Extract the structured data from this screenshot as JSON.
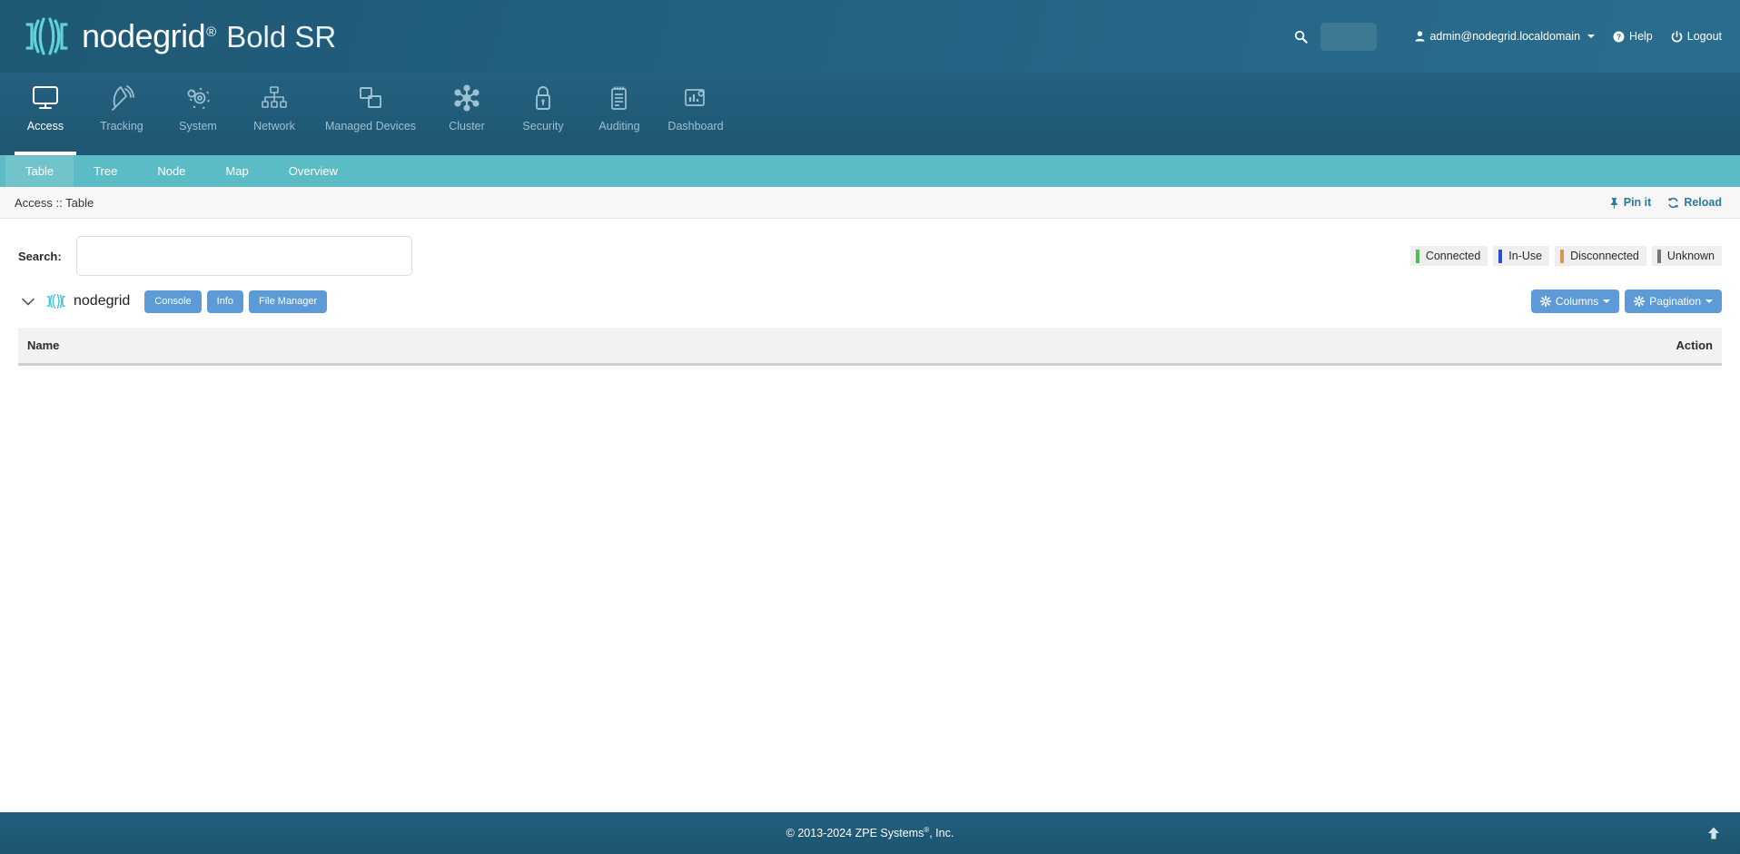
{
  "brand": {
    "name": "nodegrid",
    "registered": "®",
    "model": "Bold SR",
    "logo_icon": "nodegrid-logo-icon"
  },
  "header": {
    "search_icon": "search-icon",
    "search_value": "",
    "search_placeholder": "",
    "user": "admin@nodegrid.localdomain",
    "user_icon": "user-icon",
    "help": "Help",
    "help_icon": "question-circle-icon",
    "logout": "Logout",
    "logout_icon": "power-icon"
  },
  "mainnav": {
    "items": [
      {
        "label": "Access",
        "icon": "monitor-icon",
        "active": true
      },
      {
        "label": "Tracking",
        "icon": "satellite-dish-icon",
        "active": false
      },
      {
        "label": "System",
        "icon": "gear-icon",
        "active": false
      },
      {
        "label": "Network",
        "icon": "sitemap-icon",
        "active": false
      },
      {
        "label": "Managed Devices",
        "icon": "windows-copy-icon",
        "active": false
      },
      {
        "label": "Cluster",
        "icon": "molecule-icon",
        "active": false
      },
      {
        "label": "Security",
        "icon": "lock-icon",
        "active": false
      },
      {
        "label": "Auditing",
        "icon": "notepad-icon",
        "active": false
      },
      {
        "label": "Dashboard",
        "icon": "chart-icon",
        "active": false
      }
    ]
  },
  "subnav": {
    "items": [
      {
        "label": "Table",
        "active": true
      },
      {
        "label": "Tree",
        "active": false
      },
      {
        "label": "Node",
        "active": false
      },
      {
        "label": "Map",
        "active": false
      },
      {
        "label": "Overview",
        "active": false
      }
    ]
  },
  "breadcrumb": {
    "text": "Access :: Table",
    "pin_label": "Pin it",
    "pin_icon": "pushpin-icon",
    "reload_label": "Reload",
    "reload_icon": "refresh-icon"
  },
  "toolbar": {
    "search_label": "Search:",
    "search_value": "",
    "search_placeholder": ""
  },
  "legend": {
    "items": [
      {
        "label": "Connected",
        "color": "#4cc24c"
      },
      {
        "label": "In-Use",
        "color": "#2b4ce0"
      },
      {
        "label": "Disconnected",
        "color": "#d99557"
      },
      {
        "label": "Unknown",
        "color": "#767676"
      }
    ]
  },
  "node": {
    "toggle_icon": "chevron-down-icon",
    "logo_icon": "nodegrid-mark-icon",
    "name": "nodegrid",
    "buttons": [
      {
        "label": "Console"
      },
      {
        "label": "Info"
      },
      {
        "label": "File Manager"
      }
    ],
    "columns_label": "Columns",
    "columns_icon": "gear-icon",
    "pagination_label": "Pagination",
    "pagination_icon": "gear-icon"
  },
  "table": {
    "columns": [
      "Name",
      "Action"
    ],
    "rows": []
  },
  "footer": {
    "copyright_prefix": "© 2013-2024 ZPE Systems",
    "registered": "®",
    "copyright_suffix": ", Inc.",
    "to_top_icon": "arrow-up-icon"
  },
  "colors": {
    "header_blue": "#23607f",
    "nav_blue": "#235d7b",
    "subnav_teal": "#5cbcc5",
    "accent_link": "#2b7a9e",
    "button_blue": "#5c9bd6",
    "footer_blue": "#1f5873"
  }
}
